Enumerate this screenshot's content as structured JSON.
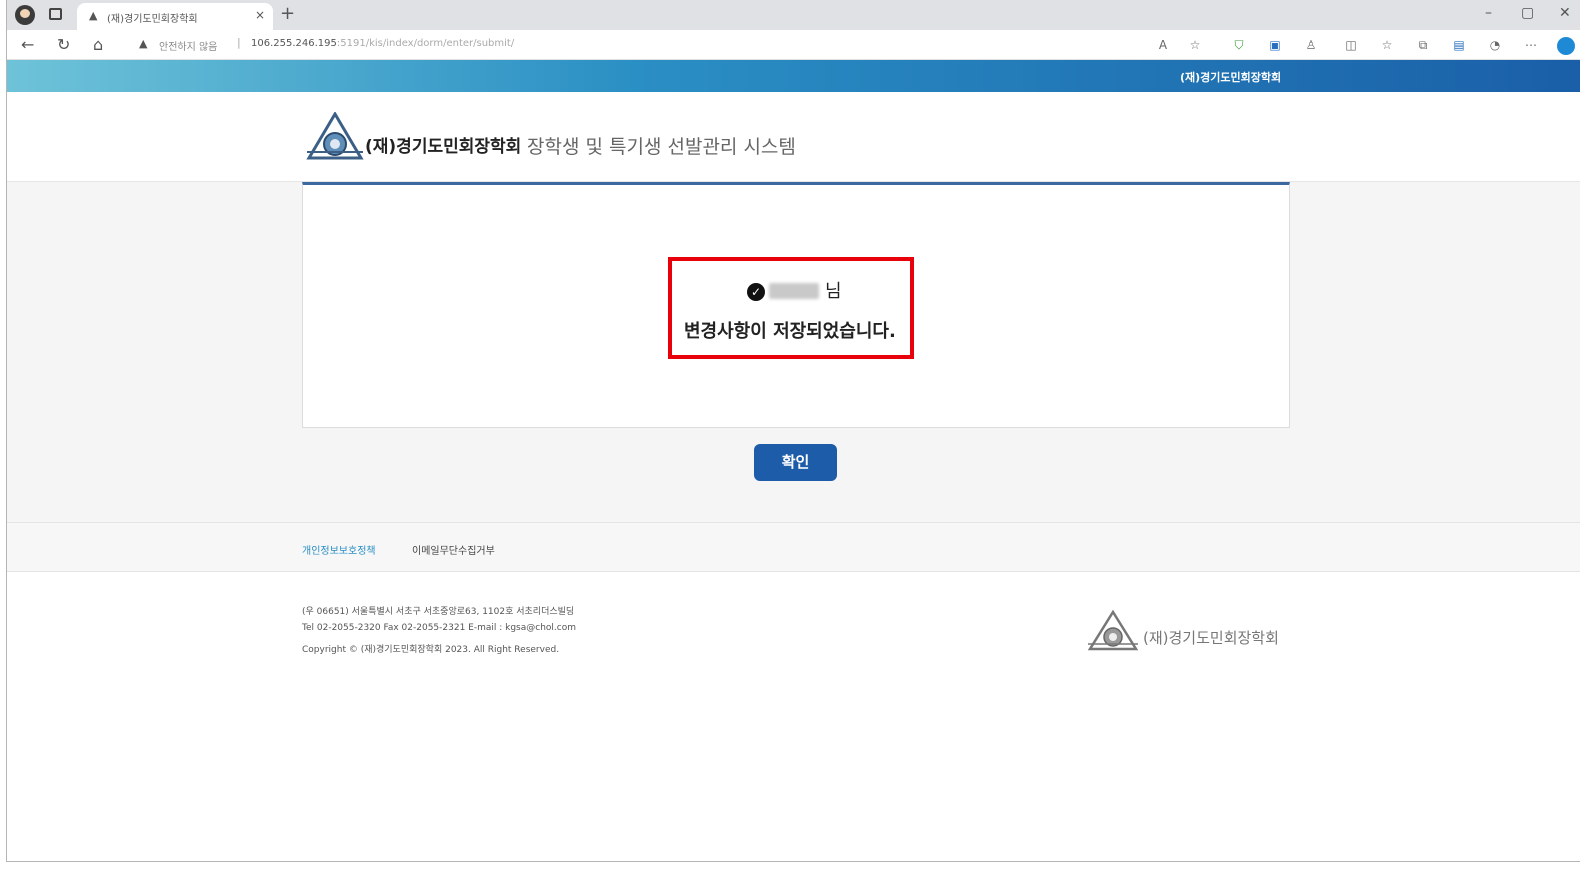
{
  "browser": {
    "tab_title": "(재)경기도민회장학회",
    "tab_close": "×",
    "new_tab": "+",
    "address_warning": "안전하지 않음",
    "address_url_host": "106.255.246.195",
    "address_url_path": ":5191/kis/index/dorm/enter/submit/",
    "minimize": "–",
    "restore": "▢",
    "close": "✕"
  },
  "site": {
    "header_strip_text": "(재)경기도민회장학회",
    "org_name": "(재)경기도민회장학회",
    "system_title": "장학생 및 특기생 선발관리 시스템"
  },
  "message": {
    "suffix": "님",
    "text": "변경사항이 저장되었습니다."
  },
  "confirm_button": "확인",
  "footer": {
    "link_privacy": "개인정보보호정책",
    "link_email": "이메일무단수집거부",
    "address": "(우 06651) 서울특별시 서초구 서초중앙로63, 1102호 서초리더스빌딩",
    "contact": "Tel 02-2055-2320 Fax 02-2055-2321 E-mail : kgsa@chol.com",
    "copyright": "Copyright © (재)경기도민회장학회 2023. All Right Reserved.",
    "logo_text": "(재)경기도민회장학회"
  },
  "colors": {
    "brand_blue": "#1d5ca8",
    "highlight_red": "#e8000b"
  }
}
